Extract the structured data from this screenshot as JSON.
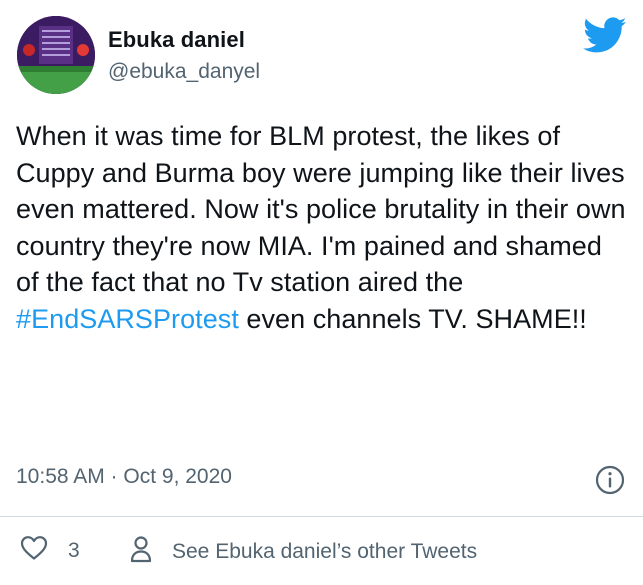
{
  "author": {
    "name": "Ebuka daniel",
    "handle": "@ebuka_danyel"
  },
  "tweet": {
    "text_before": "When it was time for BLM protest, the likes of Cuppy and Burma boy were jumping like their lives even mattered. Now it's police brutality in their own country they're now MIA. I'm pained and shamed of the fact that no Tv station aired the ",
    "hashtag": "#EndSARSProtest",
    "text_after": " even channels TV. SHAME!!"
  },
  "meta": {
    "timestamp": "10:58 AM · Oct 9, 2020"
  },
  "footer": {
    "like_count": "3",
    "other_tweets_label": "See Ebuka daniel’s other Tweets"
  },
  "icons": {
    "brand": "twitter-bird-icon",
    "info": "info-icon",
    "like": "heart-icon",
    "profile": "person-icon"
  },
  "colors": {
    "brand_blue": "#1d9bf0",
    "text_primary": "#0f1419",
    "text_secondary": "#536471",
    "divider": "#cfd9de"
  }
}
